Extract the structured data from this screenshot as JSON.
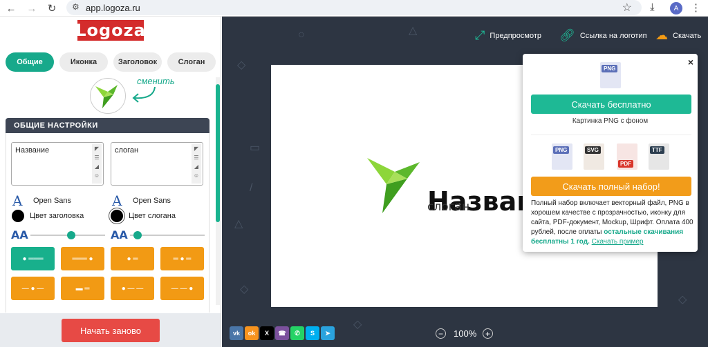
{
  "browser": {
    "url": "app.logoza.ru",
    "profile_initial": "A"
  },
  "left_panel": {
    "logo_text": "Logoza",
    "tabs": [
      "Общие",
      "Иконка",
      "Заголовок",
      "Слоган"
    ],
    "change_label": "сменить",
    "settings_title": "ОБЩИЕ НАСТРОЙКИ",
    "name_field": "Название",
    "slogan_field": "слоган",
    "name_font": "Open Sans",
    "slogan_font": "Open Sans",
    "name_color_label": "Цвет заголовка",
    "slogan_color_label": "Цвет слогана",
    "name_color": "#000000",
    "slogan_color": "#000000",
    "name_size_level": 0.55,
    "slogan_size_level": 0.05,
    "restart_label": "Начать заново"
  },
  "toolbar": {
    "preview_label": "Предпросмотр",
    "link_label": "Ссылка на логотип",
    "download_label": "Скачать"
  },
  "canvas": {
    "brand_name": "Назван",
    "brand_slogan": "слоган",
    "zoom": "100%",
    "share_icons": [
      "vk-icon",
      "odnoklassniki-icon",
      "x-icon",
      "viber-icon",
      "whatsapp-icon",
      "skype-icon",
      "telegram-icon"
    ]
  },
  "popup": {
    "close": "×",
    "png_label": "PNG",
    "free_button": "Скачать бесплатно",
    "free_sub": "Картинка PNG с фоном",
    "formats": [
      "PNG",
      "SVG",
      "PDF",
      "TTF"
    ],
    "full_button": "Скачать полный набор!",
    "desc": "Полный набор включает векторный файл, PNG в хорошем качестве с прозрачностью, иконку для сайта, PDF-документ, Mockup, Шрифт. Оплата 400 рублей, после оплаты ",
    "desc_highlight": "остальные скачивания бесплатны 1 год.",
    "desc_link": "Скачать пример"
  },
  "colors": {
    "accent_green": "#17a98b",
    "accent_orange": "#f29a14",
    "canvas_bg": "#2d3542",
    "restart_red": "#e74a45"
  }
}
